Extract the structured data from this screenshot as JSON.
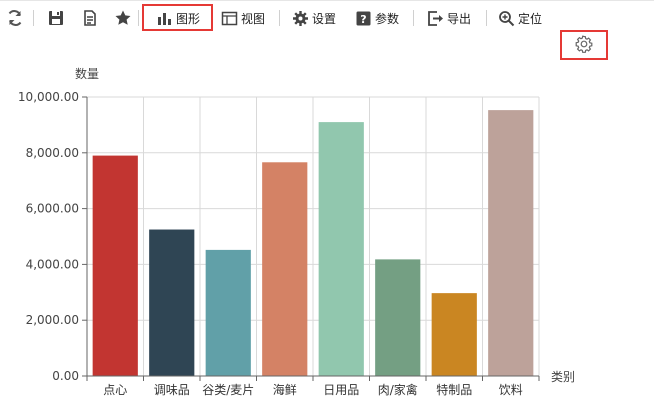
{
  "toolbar": {
    "refresh_icon": "refresh-icon",
    "save_icon": "save-icon",
    "export_doc_icon": "document-copy-icon",
    "favorite_icon": "star-icon",
    "chart_label": "图形",
    "view_label": "视图",
    "settings_label": "设置",
    "params_label": "参数",
    "export_label": "导出",
    "locate_label": "定位"
  },
  "chart_settings_icon": "gear-icon",
  "colors": {
    "highlight": "#e53935",
    "axis": "#666666",
    "grid": "#d9d9d9"
  },
  "chart_data": {
    "type": "bar",
    "ylabel": "数量",
    "xlabel": "类别",
    "categories": [
      "点心",
      "调味品",
      "谷类/麦片",
      "海鲜",
      "日用品",
      "肉/家禽",
      "特制品",
      "饮料"
    ],
    "values": [
      7900,
      5250,
      4520,
      7660,
      9100,
      4180,
      2970,
      9530
    ],
    "colors": [
      "#c23531",
      "#2f4554",
      "#61a0a8",
      "#d48265",
      "#91c7ae",
      "#749f83",
      "#ca8622",
      "#bda29a"
    ],
    "ylim": [
      0,
      10000
    ],
    "yticks": [
      0,
      2000,
      4000,
      6000,
      8000,
      10000
    ],
    "ytick_labels": [
      "0.00",
      "2,000.00",
      "4,000.00",
      "6,000.00",
      "8,000.00",
      "10,000.00"
    ],
    "grid": true
  }
}
